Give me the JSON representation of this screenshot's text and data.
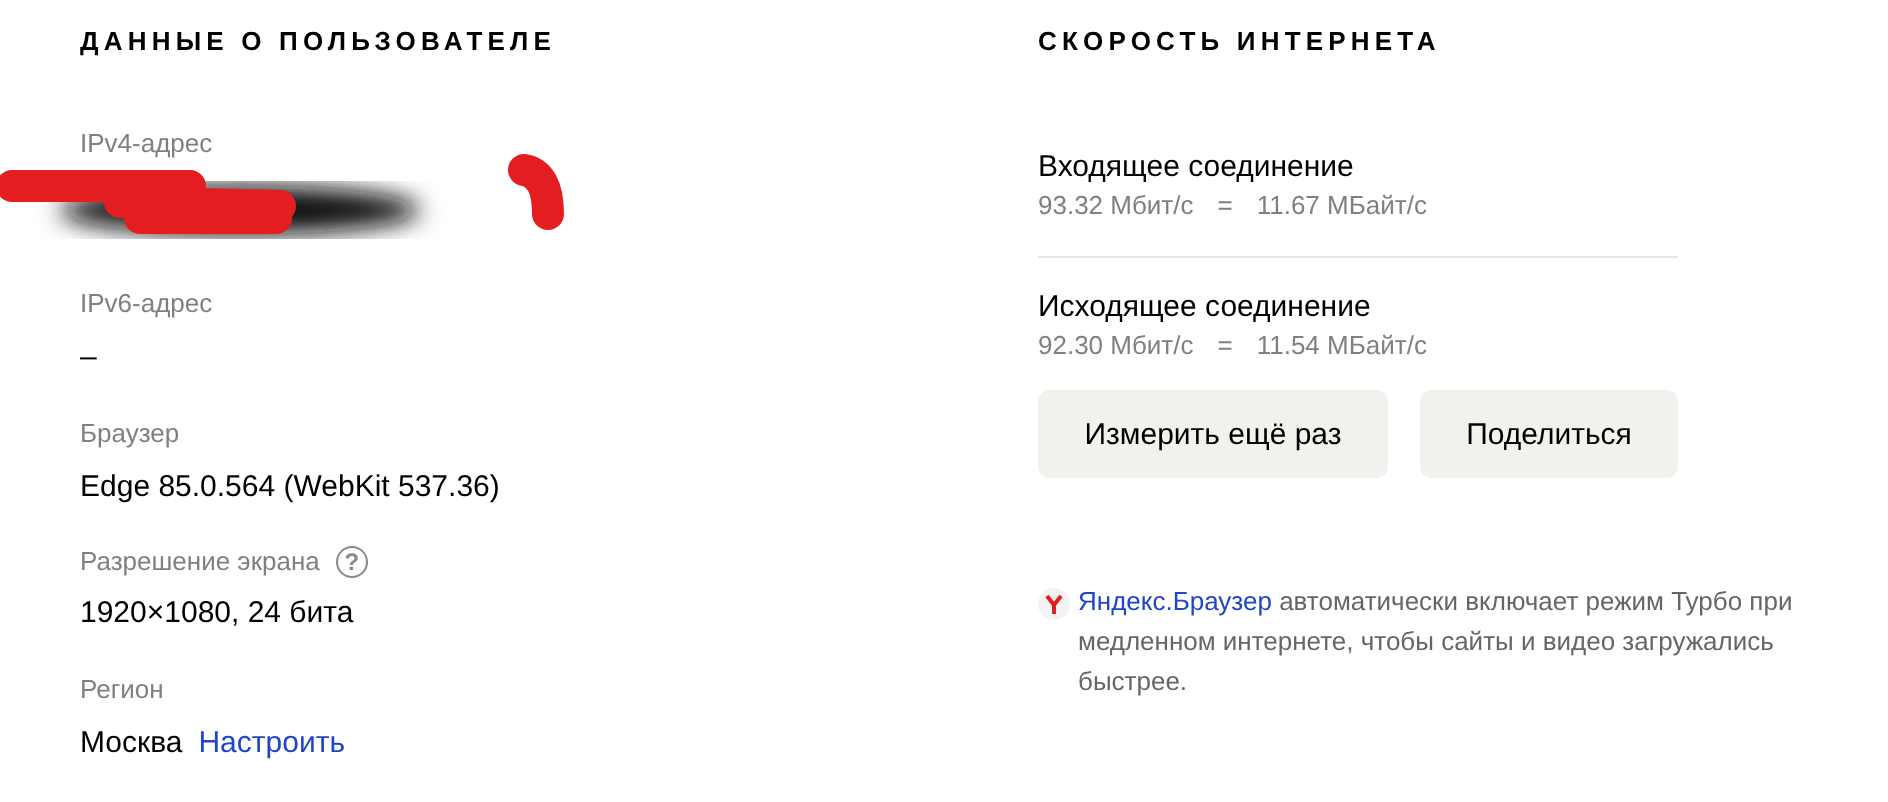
{
  "user_info": {
    "title": "ДАННЫЕ О ПОЛЬЗОВАТЕЛЕ",
    "fields": [
      {
        "kind": "redacted",
        "label": "IPv4-адрес"
      },
      {
        "kind": "text",
        "label": "IPv6-адрес",
        "value": "–"
      },
      {
        "kind": "text",
        "label": "Браузер",
        "value": "Edge 85.0.564 (WebKit 537.36)"
      },
      {
        "kind": "help",
        "label": "Разрешение экрана",
        "help": "?",
        "value": "1920×1080, 24 бита"
      },
      {
        "kind": "link",
        "label": "Регион",
        "value": "Москва",
        "link": "Настроить"
      }
    ]
  },
  "speed": {
    "title": "СКОРОСТЬ ИНТЕРНЕТА",
    "items": [
      {
        "title": "Входящее соединение",
        "mbit": "93.32 Мбит/с",
        "equals": "=",
        "mbyte": "11.67 МБайт/с"
      },
      {
        "title": "Исходящее соединение",
        "mbit": "92.30 Мбит/с",
        "equals": "=",
        "mbyte": "11.54 МБайт/с"
      }
    ],
    "buttons": [
      "Измерить ещё раз",
      "Поделиться"
    ],
    "note": {
      "link": "Яндекс.Браузер",
      "text": " автоматически включает режим Турбо при медленном интернете, чтобы сайты и видео загружались быстрее."
    }
  }
}
